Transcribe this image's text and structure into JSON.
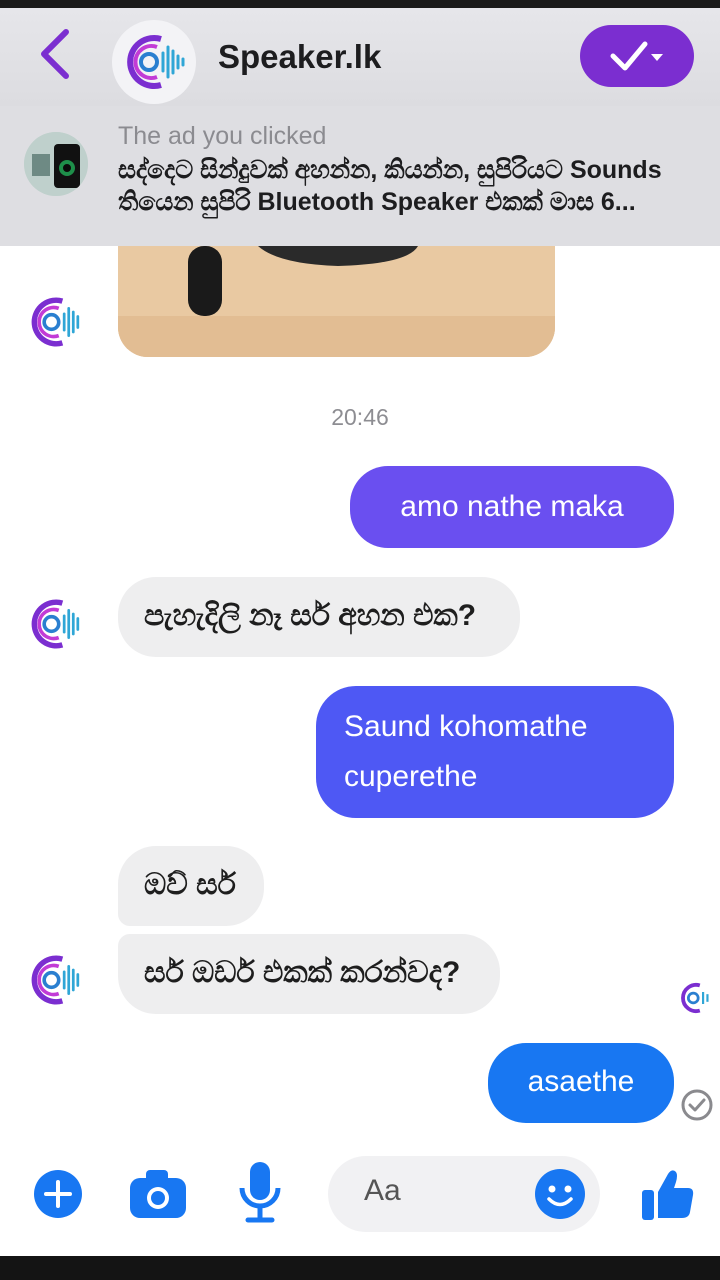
{
  "header": {
    "title": "Speaker.lk"
  },
  "ad": {
    "caption": "The ad you clicked",
    "text": "සද්දෙට සින්දුවක් අහන්න, කියන්න, සුපිරියට Sounds තියෙන සුපිරි Bluetooth Speaker එකක් මාස 6..."
  },
  "chat": {
    "timestamp": "20:46",
    "messages": [
      {
        "sender": "user",
        "text": "amo nathe maka"
      },
      {
        "sender": "page",
        "text": "පැහැදිලි නෑ සර් අහන එක?"
      },
      {
        "sender": "user",
        "text": "Saund kohomathe cuperethe"
      },
      {
        "sender": "page",
        "text": "ඔව් සර්"
      },
      {
        "sender": "page",
        "text": "සර් ඔඩර් එකක් කරන්වද?"
      },
      {
        "sender": "user",
        "text": "asaethe"
      }
    ]
  },
  "composer": {
    "placeholder": "Aa"
  },
  "colors": {
    "brand_purple": "#7b2ed0",
    "outgoing_purple": "#6a4ff0",
    "outgoing_blue": "#3b63f6",
    "messenger_blue": "#1877f2",
    "incoming_gray": "#eeeeef"
  },
  "icons": [
    "back-chevron-icon",
    "brand-logo-icon",
    "checkmark-dropdown-icon",
    "plus-icon",
    "camera-icon",
    "microphone-icon",
    "emoji-icon",
    "thumbs-up-icon",
    "seen-check-icon"
  ]
}
